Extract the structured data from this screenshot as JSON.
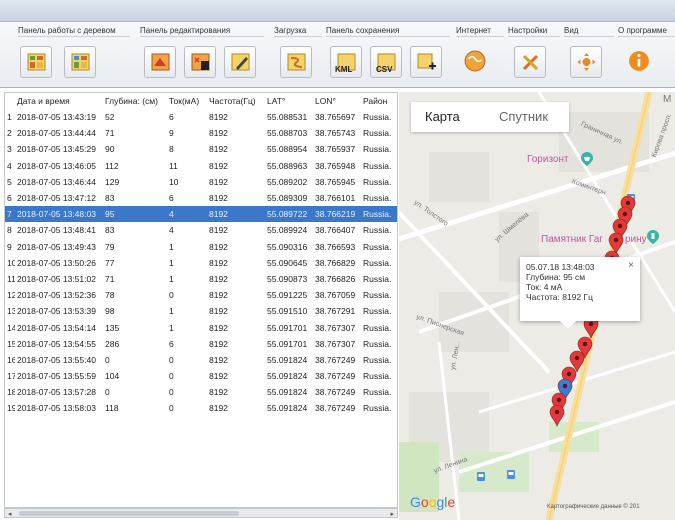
{
  "ribbon": {
    "groups": [
      {
        "label": "Панель работы с деревом"
      },
      {
        "label": "Панель редактирования"
      },
      {
        "label": "Загрузка"
      },
      {
        "label": "Панель сохранения"
      },
      {
        "label": "Интернет"
      },
      {
        "label": "Настройки"
      },
      {
        "label": "Вид"
      },
      {
        "label": "О программе"
      }
    ],
    "kml_label": "KML",
    "csv_label": "CSV"
  },
  "table": {
    "headers": [
      "",
      "Дата и время",
      "Глубина: (см)",
      "Ток(мА)",
      "Частота(Гц)",
      "LAT°",
      "LON°",
      "Район"
    ],
    "rows": [
      [
        "1",
        "2018-07-05 13:43:19",
        "52",
        "6",
        "8192",
        "55.088531",
        "38.765697",
        "Russia."
      ],
      [
        "2",
        "2018-07-05 13:44:44",
        "71",
        "9",
        "8192",
        "55.088703",
        "38.765743",
        "Russia."
      ],
      [
        "3",
        "2018-07-05 13:45:29",
        "90",
        "8",
        "8192",
        "55.088954",
        "38.765937",
        "Russia."
      ],
      [
        "4",
        "2018-07-05 13:46:05",
        "112",
        "11",
        "8192",
        "55.088963",
        "38.765948",
        "Russia."
      ],
      [
        "5",
        "2018-07-05 13:46:44",
        "129",
        "10",
        "8192",
        "55.089202",
        "38.765945",
        "Russia."
      ],
      [
        "6",
        "2018-07-05 13:47:12",
        "83",
        "6",
        "8192",
        "55.089309",
        "38.766101",
        "Russia."
      ],
      [
        "7",
        "2018-07-05 13:48:03",
        "95",
        "4",
        "8192",
        "55.089722",
        "38.766219",
        "Russia."
      ],
      [
        "8",
        "2018-07-05 13:48:41",
        "83",
        "4",
        "8192",
        "55.089924",
        "38.766407",
        "Russia."
      ],
      [
        "9",
        "2018-07-05 13:49:43",
        "79",
        "1",
        "8192",
        "55.090316",
        "38.766593",
        "Russia."
      ],
      [
        "10",
        "2018-07-05 13:50:26",
        "77",
        "1",
        "8192",
        "55.090645",
        "38.766829",
        "Russia."
      ],
      [
        "11",
        "2018-07-05 13:51:02",
        "71",
        "1",
        "8192",
        "55.090873",
        "38.766826",
        "Russia."
      ],
      [
        "12",
        "2018-07-05 13:52:36",
        "78",
        "0",
        "8192",
        "55.091225",
        "38.767059",
        "Russia."
      ],
      [
        "13",
        "2018-07-05 13:53:39",
        "98",
        "1",
        "8192",
        "55.091510",
        "38.767291",
        "Russia."
      ],
      [
        "14",
        "2018-07-05 13:54:14",
        "135",
        "1",
        "8192",
        "55.091701",
        "38.767307",
        "Russia."
      ],
      [
        "15",
        "2018-07-05 13:54:55",
        "286",
        "6",
        "8192",
        "55.091701",
        "38.767307",
        "Russia."
      ],
      [
        "16",
        "2018-07-05 13:55:40",
        "0",
        "0",
        "8192",
        "55.091824",
        "38.767249",
        "Russia."
      ],
      [
        "17",
        "2018-07-05 13:55:59",
        "104",
        "0",
        "8192",
        "55.091824",
        "38.767249",
        "Russia."
      ],
      [
        "18",
        "2018-07-05 13:57:28",
        "0",
        "0",
        "8192",
        "55.091824",
        "38.767249",
        "Russia."
      ],
      [
        "19",
        "2018-07-05 13:58:03",
        "118",
        "0",
        "8192",
        "55.091824",
        "38.767249",
        "Russia."
      ]
    ],
    "selected_row": "7",
    "selected_color": "#3b78c9"
  },
  "map": {
    "tabs": {
      "map": "Карта",
      "satellite": "Спутник"
    },
    "poi": {
      "gorizont": "Горизонт",
      "pamyatnik": "Памятник Гаг",
      "pamyatnik_tail": "рину"
    },
    "streets": {
      "kirova": "Кирова просп.",
      "granichnaya": "Граничная ул.",
      "tolstogo": "ул. Толстого",
      "shmelina": "ул. Шмелёва",
      "pioneer": "ул. Пионерская",
      "kominter": "Коминтерн",
      "chekhova": "ул. Лен...",
      "bottom": "ул. Ленина"
    },
    "infowindow": {
      "datetime": "05.07.18 13:48:03",
      "depth": "Глубина: 95 см",
      "current": "Ток: 4 мА",
      "frequency": "Частота: 8192 Гц",
      "close": "×"
    },
    "google_logo": "Google",
    "attribution": "Картографические данные © 201",
    "top_right_label": "М",
    "marker_color": "#e03a3a",
    "selected_marker_color": "#3a7bd5"
  }
}
